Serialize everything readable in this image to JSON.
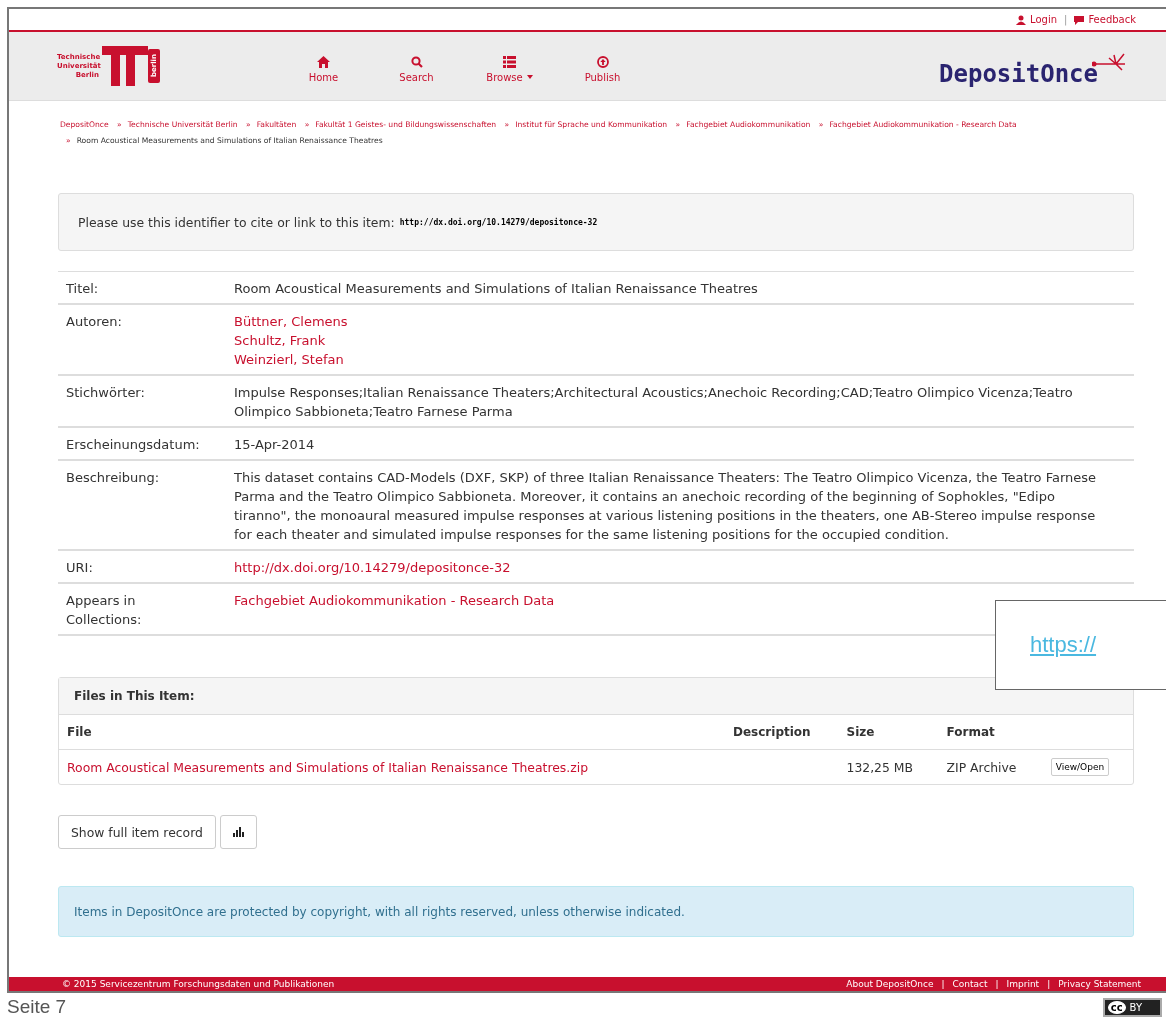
{
  "top_bar": {
    "links": [
      {
        "label": "Login"
      },
      {
        "label": "Feedback"
      }
    ],
    "separator": "|"
  },
  "header": {
    "logo_left": {
      "text": "Technische Universität Berlin",
      "tag": "berlin"
    },
    "nav": [
      {
        "label": "Home",
        "dropdown": false
      },
      {
        "label": "Search",
        "dropdown": false
      },
      {
        "label": "Browse",
        "dropdown": true
      },
      {
        "label": "Publish",
        "dropdown": false
      }
    ],
    "brand": "DepositOnce"
  },
  "breadcrumbs": [
    {
      "label": "DepositOnce",
      "kind": "link"
    },
    {
      "label": "Technische Universität Berlin",
      "kind": "link"
    },
    {
      "label": "Fakultäten",
      "kind": "link"
    },
    {
      "label": "Fakultät 1 Geistes- und Bildungswissenschaften",
      "kind": "link"
    },
    {
      "label": "Institut für Sprache und Kommunikation",
      "kind": "link"
    },
    {
      "label": "Fachgebiet Audiokommunikation",
      "kind": "link"
    },
    {
      "label": "Fachgebiet Audiokommunikation - Research Data",
      "kind": "link"
    },
    {
      "label": "Room Acoustical Measurements and Simulations of Italian Renaissance Theatres",
      "kind": "current"
    }
  ],
  "breadcrumb_separator": "»",
  "cite": {
    "label": "Please use this identifier to cite or link to this item:",
    "url": "http://dx.doi.org/10.14279/depositonce-32"
  },
  "metadata": [
    {
      "label": "Titel:",
      "kind": "text",
      "values": [
        "Room Acoustical Measurements and Simulations of Italian Renaissance Theatres"
      ]
    },
    {
      "label": "Autoren:",
      "kind": "link",
      "values": [
        "Büttner, Clemens",
        "Schultz, Frank",
        "Weinzierl, Stefan"
      ]
    },
    {
      "label": "Stichwörter:",
      "kind": "text",
      "values": [
        "Impulse Responses;Italian Renaissance Theaters;Architectural Acoustics;Anechoic Recording;CAD;Teatro Olimpico Vicenza;Teatro Olimpico Sabbioneta;Teatro Farnese Parma"
      ]
    },
    {
      "label": "Erscheinungsdatum:",
      "kind": "text",
      "values": [
        "15-Apr-2014"
      ]
    },
    {
      "label": "Beschreibung:",
      "kind": "text",
      "values": [
        "This dataset contains CAD-Models (DXF, SKP) of three Italian Renaissance Theaters: The Teatro Olimpico Vicenza, the Teatro Farnese Parma and the Teatro Olimpico Sabbioneta. Moreover, it contains an anechoic recording of the beginning of Sophokles, \"Edipo tiranno\", the monoaural measured impulse responses at various listening positions in the theaters, one AB-Stereo impulse response for each theater and simulated impulse responses for the same listening positions for the occupied condition."
      ]
    },
    {
      "label": "URI:",
      "kind": "link",
      "values": [
        "http://dx.doi.org/10.14279/depositonce-32"
      ]
    },
    {
      "label": "Appears in Collections:",
      "kind": "link",
      "values": [
        "Fachgebiet Audiokommunikation - Research Data"
      ]
    }
  ],
  "overlay_link": "https://",
  "files": {
    "title": "Files in This Item:",
    "columns": [
      "File",
      "Description",
      "Size",
      "Format"
    ],
    "rows": [
      {
        "file": "Room Acoustical Measurements and Simulations of Italian Renaissance Theatres.zip",
        "size": "132,25 MB",
        "format": "ZIP Archive",
        "action": "View/Open"
      }
    ]
  },
  "buttons": [
    {
      "label": "Show full item record",
      "kind": "text"
    },
    {
      "kind": "stats"
    }
  ],
  "notice": "Items in DepositOnce are protected by copyright, with all rights reserved, unless otherwise indicated.",
  "footer": {
    "copyright": "© 2015 Servicezentrum Forschungsdaten und Publikationen",
    "links": [
      "About DepositOnce",
      "Contact",
      "Imprint",
      "Privacy Statement"
    ],
    "separator": "|"
  },
  "page_label": "Seite 7",
  "license": {
    "symbol": "cc",
    "text": "BY"
  }
}
